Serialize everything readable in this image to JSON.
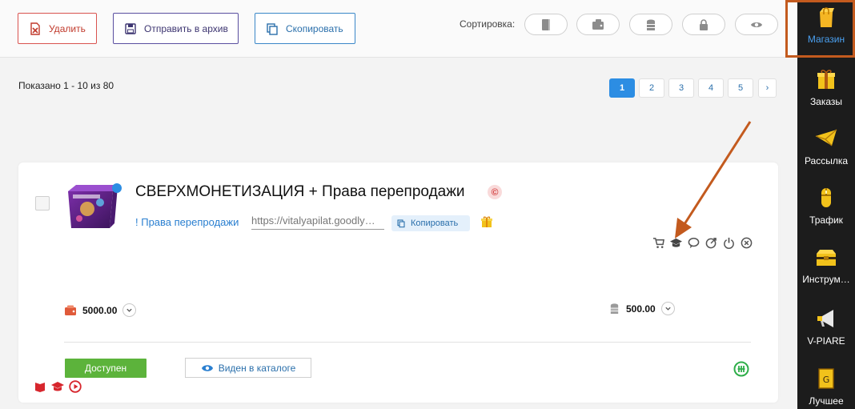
{
  "toolbar": {
    "delete_label": "Удалить",
    "archive_label": "Отправить в архив",
    "copy_label": "Скопировать",
    "sort_label": "Сортировка:",
    "sort_icons": [
      "book-icon",
      "wallet-icon",
      "coins-icon",
      "lock-icon",
      "eye-icon"
    ]
  },
  "listing": {
    "shown_text": "Показано 1 - 10 из 80",
    "pages": [
      "1",
      "2",
      "3",
      "4",
      "5"
    ],
    "active_page": "1",
    "next_label": "›"
  },
  "product": {
    "title": "СВЕРХМОНЕТИЗАЦИЯ + Права перепродажи",
    "copyright_badge": "©",
    "link_text": "! Права перепродажи",
    "url_value": "https://vitalyapilat.goodly…",
    "copy_label": "Копировать",
    "price_main": "5000.00",
    "price_secondary": "500.00",
    "status_label": "Доступен",
    "catalog_label": "Виден в каталоге",
    "action_icons": [
      "cart-icon",
      "graduation-cap-icon",
      "comment-icon",
      "target-icon",
      "power-icon",
      "close-circle-icon"
    ]
  },
  "sidebar": {
    "items": [
      {
        "label": "Магазин",
        "icon": "shopping-bag-icon",
        "active": true
      },
      {
        "label": "Заказы",
        "icon": "gift-box-icon"
      },
      {
        "label": "Рассылка",
        "icon": "envelope-icon"
      },
      {
        "label": "Трафик",
        "icon": "mouse-icon"
      },
      {
        "label": "Инструм…",
        "icon": "toolbox-icon"
      },
      {
        "label": "V-PIARE",
        "icon": "megaphone-icon"
      },
      {
        "label": "Лучшее",
        "icon": "trophy-icon"
      }
    ]
  },
  "colors": {
    "accent_blue": "#2c8de3",
    "delete_red": "#d9534f",
    "available_green": "#5cb33b",
    "highlight_orange": "#c35a1e",
    "sidebar_bg": "#1c1c1c"
  }
}
